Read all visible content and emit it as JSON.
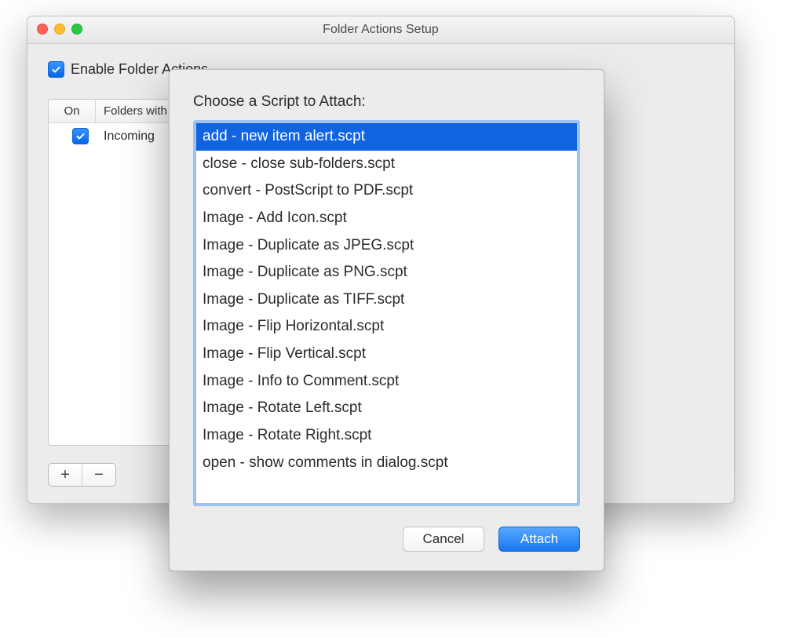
{
  "window": {
    "title": "Folder Actions Setup"
  },
  "enable": {
    "label": "Enable Folder Actions",
    "checked": true
  },
  "folders_table": {
    "columns": {
      "on": "On",
      "name": "Folders with Actions"
    },
    "rows": [
      {
        "on": true,
        "name": "Incoming"
      }
    ]
  },
  "segmented": {
    "add": "+",
    "remove": "−"
  },
  "sheet": {
    "title": "Choose a Script to Attach:",
    "selected_index": 0,
    "scripts": [
      "add - new item alert.scpt",
      "close - close sub-folders.scpt",
      "convert - PostScript to PDF.scpt",
      "Image - Add Icon.scpt",
      "Image - Duplicate as JPEG.scpt",
      "Image - Duplicate as PNG.scpt",
      "Image - Duplicate as TIFF.scpt",
      "Image - Flip Horizontal.scpt",
      "Image - Flip Vertical.scpt",
      "Image - Info to Comment.scpt",
      "Image - Rotate Left.scpt",
      "Image - Rotate Right.scpt",
      "open - show comments in dialog.scpt"
    ],
    "buttons": {
      "cancel": "Cancel",
      "attach": "Attach"
    }
  }
}
